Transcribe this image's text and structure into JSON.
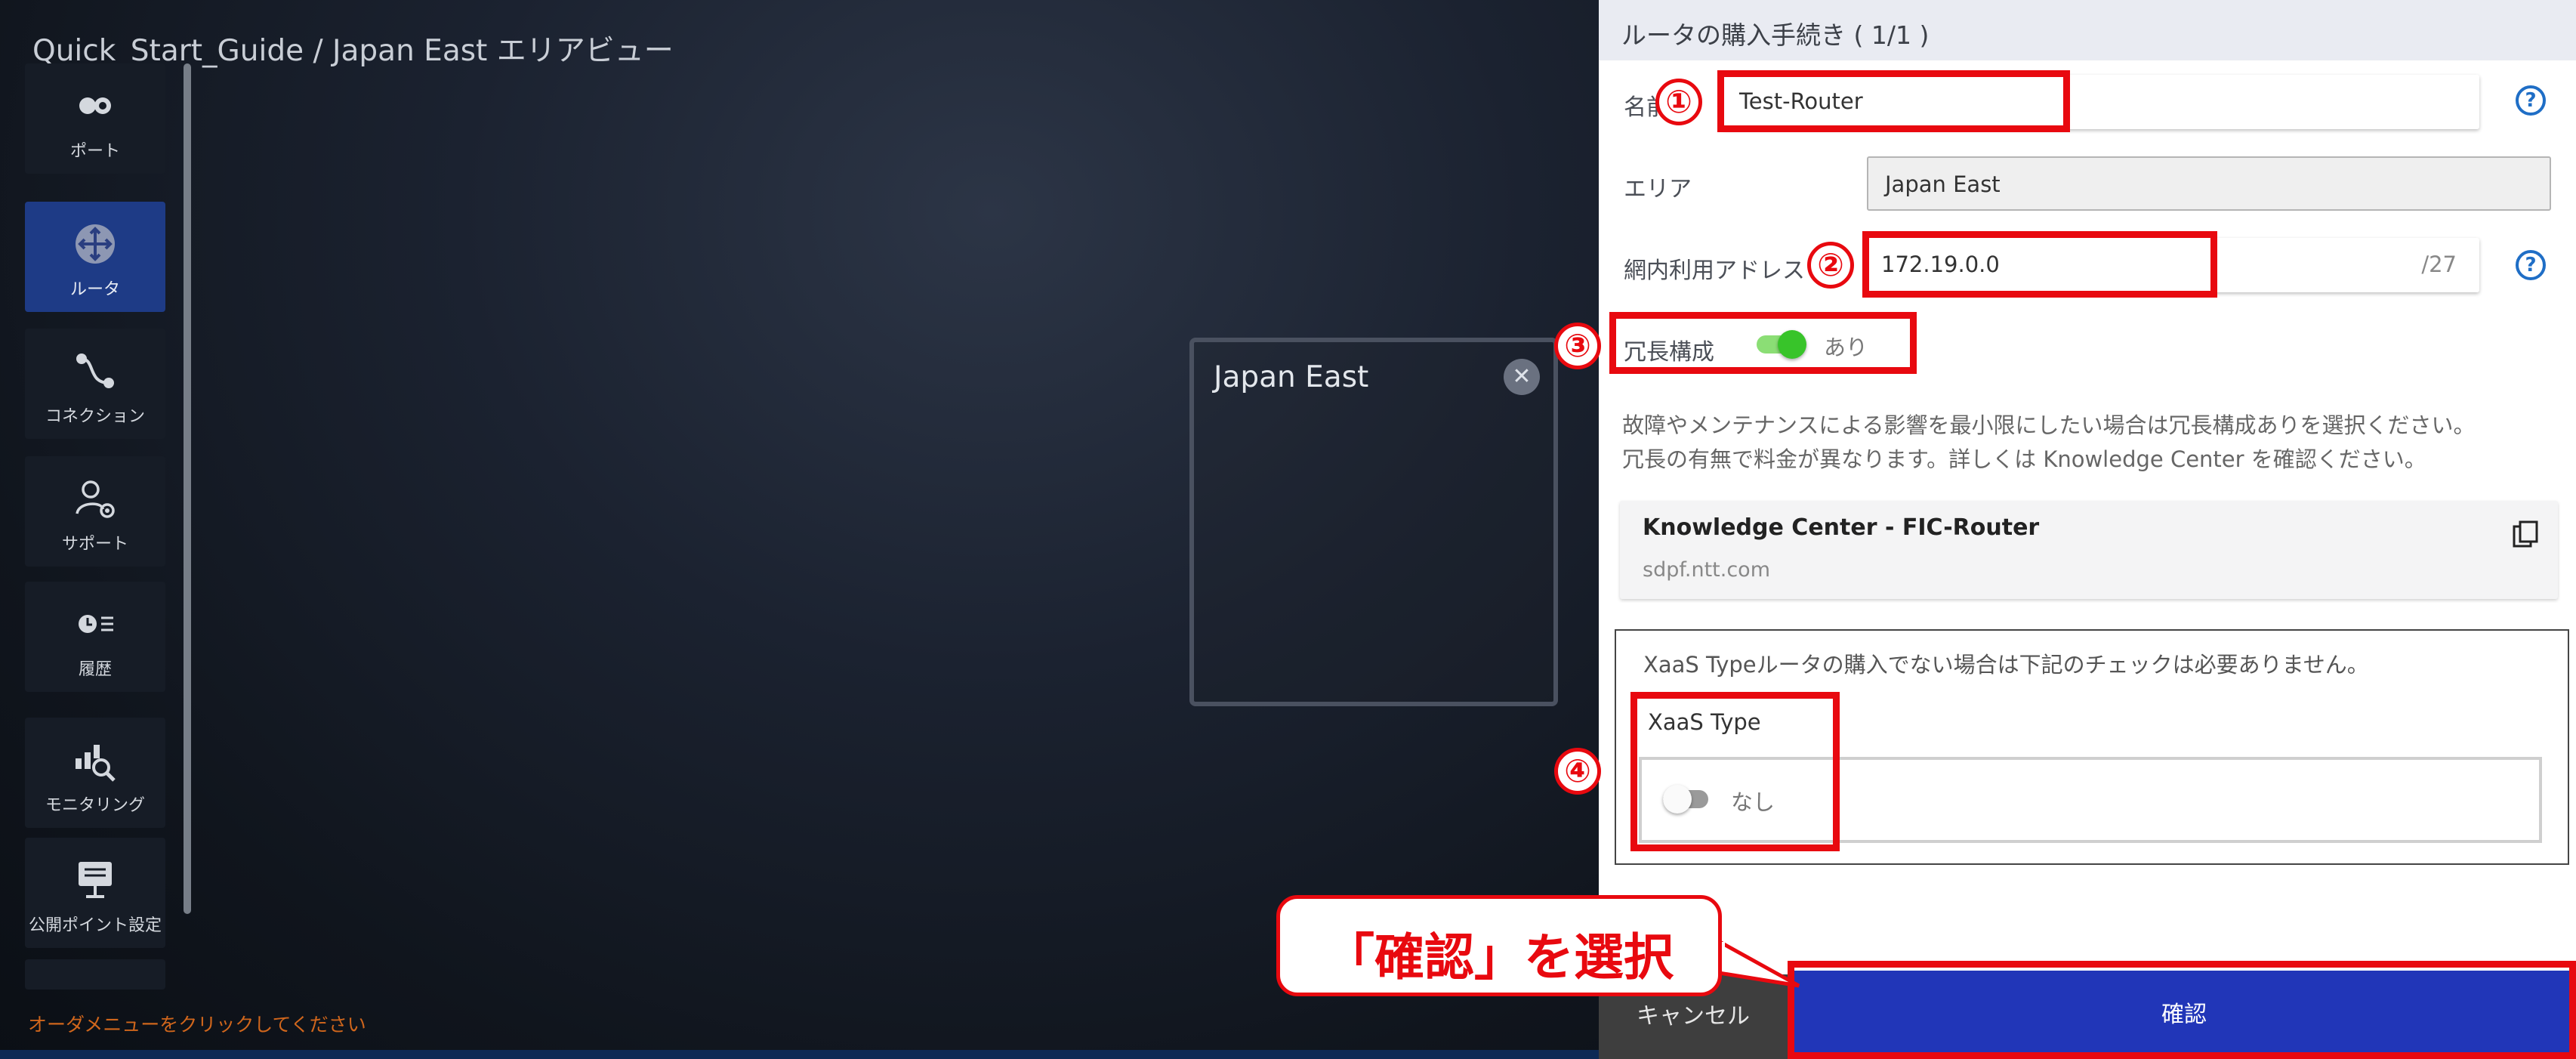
{
  "breadcrumb": "Quick_Start_Guide / Japan East エリアビュー",
  "sidebar": {
    "items": [
      {
        "label": "ポート",
        "icon": "port-icon"
      },
      {
        "label": "ルータ",
        "icon": "router-icon",
        "active": true
      },
      {
        "label": "コネクション",
        "icon": "connection-icon"
      },
      {
        "label": "サポート",
        "icon": "support-icon"
      },
      {
        "label": "履歴",
        "icon": "history-icon"
      },
      {
        "label": "モニタリング",
        "icon": "monitoring-icon"
      },
      {
        "label": "公開ポイント設定",
        "icon": "public-point-icon"
      }
    ]
  },
  "footer_hint": "オーダメニューをクリックしてください",
  "area_card": {
    "title": "Japan East"
  },
  "panel": {
    "header": "ルータの購入手続き ( 1/1 )",
    "name_label": "名前",
    "name_value": "Test-Router",
    "area_label": "エリア",
    "area_value": "Japan East",
    "address_label": "網内利用アドレス",
    "address_value": "172.19.0.0",
    "address_suffix": "/27",
    "redundancy_label": "冗長構成",
    "redundancy_value": "あり",
    "redundancy_note_1": "故障やメンテナンスによる影響を最小限にしたい場合は冗長構成ありを選択ください。",
    "redundancy_note_2": "冗長の有無で料金が異なります。詳しくは Knowledge Center を確認ください。",
    "kc_title": "Knowledge Center - FIC-Router",
    "kc_url": "sdpf.ntt.com",
    "xaas_note": "XaaS Typeルータの購入でない場合は下記のチェックは必要ありません。",
    "xaas_title": "XaaS Type",
    "xaas_value": "なし",
    "cancel_label": "キャンセル",
    "confirm_label": "確認"
  },
  "annotations": {
    "n1": "①",
    "n2": "②",
    "n3": "③",
    "n4": "④",
    "callout": "「確認」を選択"
  },
  "colors": {
    "accent": "#2136b8",
    "highlight": "#e8090f",
    "toggle_on": "#38c42a",
    "active_nav": "#1e3b86"
  }
}
